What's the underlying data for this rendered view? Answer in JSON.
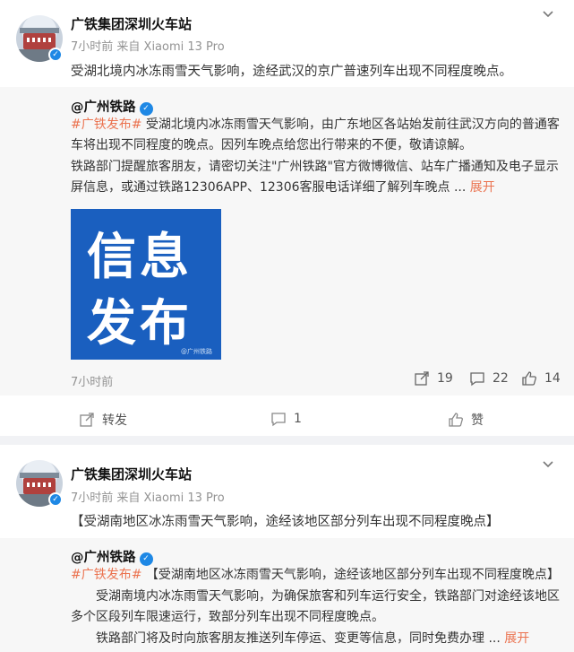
{
  "post1": {
    "username": "广铁集团深圳火车站",
    "meta": "7小时前  来自 Xiaomi 13 Pro",
    "text": "受湖北境内冰冻雨雪天气影响，途经武汉的京广普速列车出现不同程度晚点。",
    "repost": {
      "user": "@广州铁路",
      "tag": "#广铁发布#",
      "para1_rest": " 受湖北境内冰冻雨雪天气影响，由广东地区各站始发前往武汉方向的普通客车将出现不同程度的晚点。因列车晚点给您出行带来的不便，敬请谅解。",
      "para2": "铁路部门提醒旅客朋友，请密切关注\"广州铁路\"官方微博微信、站车广播通知及电子显示屏信息，或通过铁路12306APP、12306客服电话详细了解列车晚点 ...",
      "expand": "展开",
      "image_line1": "信息",
      "image_line2": "发布",
      "image_watermark": "@广州铁路",
      "time": "7小时前",
      "share_count": "19",
      "comment_count": "22",
      "like_count": "14"
    },
    "actions": {
      "share": "转发",
      "comment": "1",
      "like": "赞"
    }
  },
  "post2": {
    "username": "广铁集团深圳火车站",
    "meta": "7小时前  来自 Xiaomi 13 Pro",
    "text": "【受湖南地区冰冻雨雪天气影响，途经该地区部分列车出现不同程度晚点】",
    "repost": {
      "user": "@广州铁路",
      "tag": "#广铁发布#",
      "title_rest": " 【受湖南地区冰冻雨雪天气影响，途经该地区部分列车出现不同程度晚点】",
      "para1": "受湖南境内冰冻雨雪天气影响，为确保旅客和列车运行安全，铁路部门对途经该地区多个区段列车限速运行，致部分列车出现不同程度晚点。",
      "para2": "铁路部门将及时向旅客朋友推送列车停运、变更等信息，同时免费办理 ...",
      "expand": "展开"
    }
  }
}
